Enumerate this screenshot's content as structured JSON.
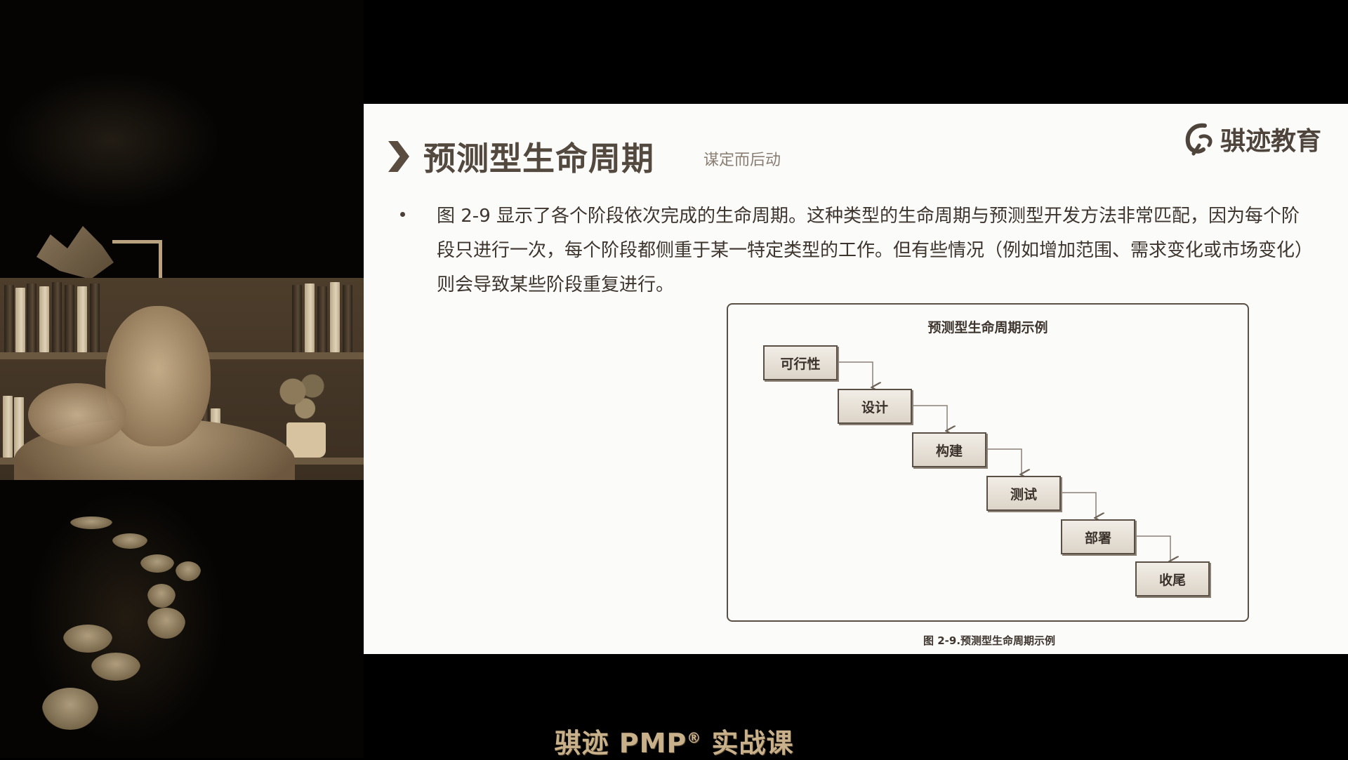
{
  "slide": {
    "title": "预测型生命周期",
    "subtitle": "谋定而后动",
    "logo_text": "骐迹教育",
    "bullet_text": "图 2-9 显示了各个阶段依次完成的生命周期。这种类型的生命周期与预测型开发方法非常匹配，因为每个阶段只进行一次，每个阶段都侧重于某一特定类型的工作。但有些情况（例如增加范围、需求变化或市场变化）则会导致某些阶段重复进行。",
    "figure": {
      "title": "预测型生命周期示例",
      "steps": [
        "可行性",
        "设计",
        "构建",
        "测试",
        "部署",
        "收尾"
      ],
      "caption": "图 2-9.预测型生命周期示例"
    }
  },
  "footer": {
    "course_prefix": "骐迹 PMP",
    "course_registered": "®",
    "course_suffix": " 实战课"
  },
  "colors": {
    "title": "#54493f",
    "accent": "#c8b08a",
    "slide_bg": "#fbfbfa"
  }
}
